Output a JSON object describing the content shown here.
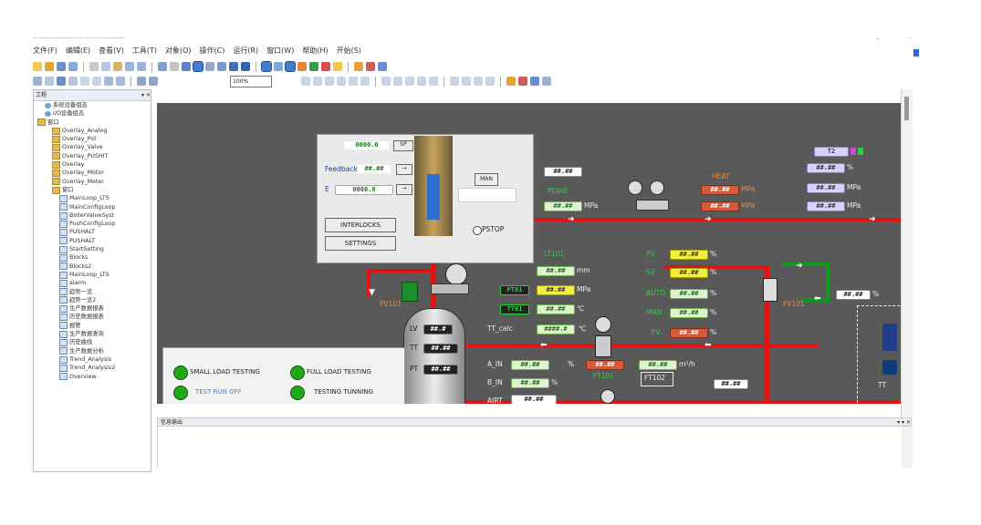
{
  "window": {
    "title": "-- ------- ---------- ---- -- ----- ---- ------"
  },
  "menu": [
    "文件(F)",
    "编辑(E)",
    "查看(V)",
    "工具(T)",
    "对象(O)",
    "操作(C)",
    "运行(R)",
    "窗口(W)",
    "帮助(H)",
    "开始(S)"
  ],
  "toolbar": {
    "zoom_value": "100%"
  },
  "side_panel": {
    "title": "工程",
    "items": [
      {
        "label": "系统设备组态",
        "icon": "cfg-icon",
        "indent": 1
      },
      {
        "label": "I/O设备组态",
        "icon": "cfg-icon",
        "indent": 1
      },
      {
        "label": "窗口",
        "icon": "folder-icon",
        "indent": 0
      },
      {
        "label": "Overlay_Analog",
        "icon": "folder-icon",
        "indent": 2
      },
      {
        "label": "Overlay_Pid",
        "icon": "folder-icon",
        "indent": 2
      },
      {
        "label": "Overlay_Valve",
        "icon": "folder-icon",
        "indent": 2
      },
      {
        "label": "Overlay_PUSHIT",
        "icon": "folder-icon",
        "indent": 2
      },
      {
        "label": "Overlay",
        "icon": "folder-icon",
        "indent": 2
      },
      {
        "label": "Overlay_Motor",
        "icon": "folder-icon",
        "indent": 2
      },
      {
        "label": "Overlay_Meter",
        "icon": "folder-icon",
        "indent": 2
      },
      {
        "label": "窗口",
        "icon": "folder-icon",
        "indent": 2
      },
      {
        "label": "MainLoop_LTS",
        "icon": "doc-icon",
        "indent": 3
      },
      {
        "label": "MainConfigLoop",
        "icon": "doc-icon",
        "indent": 3
      },
      {
        "label": "BoilerValueSyst",
        "icon": "doc-icon",
        "indent": 3
      },
      {
        "label": "PushConfigLoop",
        "icon": "doc-icon",
        "indent": 3
      },
      {
        "label": "PUSHALT",
        "icon": "doc-icon",
        "indent": 3
      },
      {
        "label": "PUSHALT",
        "icon": "doc-icon",
        "indent": 3
      },
      {
        "label": "StartSetting",
        "icon": "doc-icon",
        "indent": 3
      },
      {
        "label": "Blocks",
        "icon": "doc-icon",
        "indent": 3
      },
      {
        "label": "Blocks2",
        "icon": "doc-icon",
        "indent": 3
      },
      {
        "label": "MainLoop_LTS",
        "icon": "doc-icon",
        "indent": 3
      },
      {
        "label": "alarm",
        "icon": "doc-icon",
        "indent": 3
      },
      {
        "label": "趋势一览",
        "icon": "doc-icon",
        "indent": 3
      },
      {
        "label": "趋势一览2",
        "icon": "doc-icon",
        "indent": 3
      },
      {
        "label": "生产数据报表",
        "icon": "doc-icon",
        "indent": 3
      },
      {
        "label": "历史数据报表",
        "icon": "doc-icon",
        "indent": 3
      },
      {
        "label": "报警",
        "icon": "doc-icon",
        "indent": 3
      },
      {
        "label": "生产数据查询",
        "icon": "doc-icon",
        "indent": 3
      },
      {
        "label": "历史曲线",
        "icon": "doc-icon",
        "indent": 3
      },
      {
        "label": "生产数据分析",
        "icon": "doc-icon",
        "indent": 3
      },
      {
        "label": "Trend_Analysis",
        "icon": "doc-icon",
        "indent": 3
      },
      {
        "label": "Trend_Analysis2",
        "icon": "doc-icon",
        "indent": 3
      },
      {
        "label": "Overview",
        "icon": "doc-icon",
        "indent": 3
      }
    ]
  },
  "faceplate": {
    "sp_value": "0000.0",
    "sp_unit": "SP",
    "feedback_label": "Feedback",
    "feedback_value": "##.##",
    "e_label": "E",
    "e_value": "0000.0",
    "auto_label": "MAN",
    "interlocks_button": "INTERLOCKS",
    "settings_button": "SETTINGS",
    "pstop_label": "PSTOP"
  },
  "test_panel": {
    "items": [
      {
        "label": "SMALL LOAD TESTING"
      },
      {
        "label": "FULL LOAD TESTING"
      },
      {
        "label": "TEST RUN OFF"
      },
      {
        "label": "TESTING TUNNING"
      }
    ]
  },
  "process": {
    "top_value": "##.##",
    "pdire_label": "PDIRE",
    "pdire_value": "##.##",
    "pdire_unit": "MPa",
    "heater_tag": "HEAT",
    "heater_val1": "##.##",
    "heater_unit1": "MPa",
    "heater_val2": "##.##",
    "heater_unit2": "MPa",
    "right_top_tag": "T2",
    "right_val1": "##.##",
    "right_unit1": "%",
    "right_val2": "##.##",
    "right_unit2": "MPa",
    "right_val3": "##.##",
    "right_unit3": "MPa",
    "lt1_label": "LT101",
    "lt1_val": "##.##",
    "lt1_unit": "mm",
    "pt_label": "PT01",
    "pt_val": "##.##",
    "pt_unit": "MPa",
    "tt_label": "TT01",
    "tt_val": "##.##",
    "tt_unit": "℃",
    "tt_calc_label": "TT_calc",
    "tt_calc_val": "####.#",
    "tt_calc_unit": "℃",
    "mid_tag": "LT101",
    "y1_label": "PV",
    "y1_val": "##.##",
    "y1_unit": "%",
    "y2_label": "SV",
    "y2_val": "##.##",
    "y2_unit": "%",
    "aut_label": "AUTO",
    "aut_val": "##.##",
    "aut_unit": "%",
    "man_label": "MAN",
    "man_val": "##.##",
    "man_unit": "%",
    "fv_label": "FV",
    "fv_val": "##.##",
    "fv_unit": "%",
    "valve_tag": "FV101",
    "valve_val": "##.##",
    "valve_unit": "%",
    "tank_v1": "##.#",
    "tank_v2": "##.##",
    "tank_v3": "##.##",
    "tank_l1": "LV",
    "tank_l2": "TT",
    "tank_l3": "PT",
    "bot_l1_label": "A_IN",
    "bot_l1_val": "##.##",
    "bot_l1_unit": "%",
    "bot_l2_label": "B_IN",
    "bot_l2_val": "##.##",
    "bot_l2_unit": "%",
    "bot_l3_label": "AIRT",
    "bot_l3_val": "##.##",
    "bot_flow_label": "FT101",
    "bot_flow_val": "##.##",
    "bot_flow_unit": "m³/h",
    "bot_box_label": "FT102",
    "bot_right_val": "##.##",
    "bot_right_unit": "m³/h",
    "right_edge_tag": "TT",
    "left_valve_tag": "PV101",
    "far_right_val": "##.##",
    "far_right_unit": "%"
  },
  "output_panel": {
    "title": "信息输出"
  }
}
